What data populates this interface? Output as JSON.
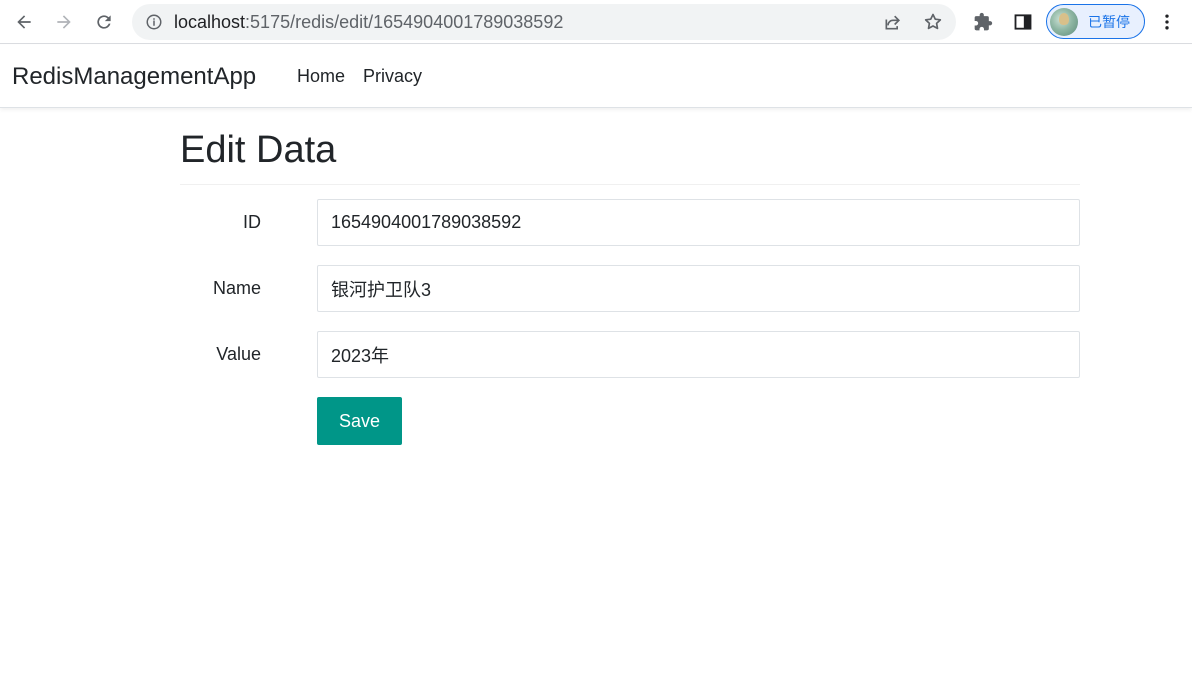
{
  "browser": {
    "url_host": "localhost",
    "url_rest": ":5175/redis/edit/1654904001789038592",
    "profile_label": "已暂停"
  },
  "navbar": {
    "brand": "RedisManagementApp",
    "links": [
      "Home",
      "Privacy"
    ]
  },
  "page": {
    "title": "Edit Data"
  },
  "form": {
    "fields": [
      {
        "label": "ID",
        "value": "1654904001789038592"
      },
      {
        "label": "Name",
        "value": "银河护卫队3"
      },
      {
        "label": "Value",
        "value": "2023年"
      }
    ],
    "submit_label": "Save"
  },
  "colors": {
    "primary_button": "#009688",
    "profile_accent": "#1a73e8"
  }
}
